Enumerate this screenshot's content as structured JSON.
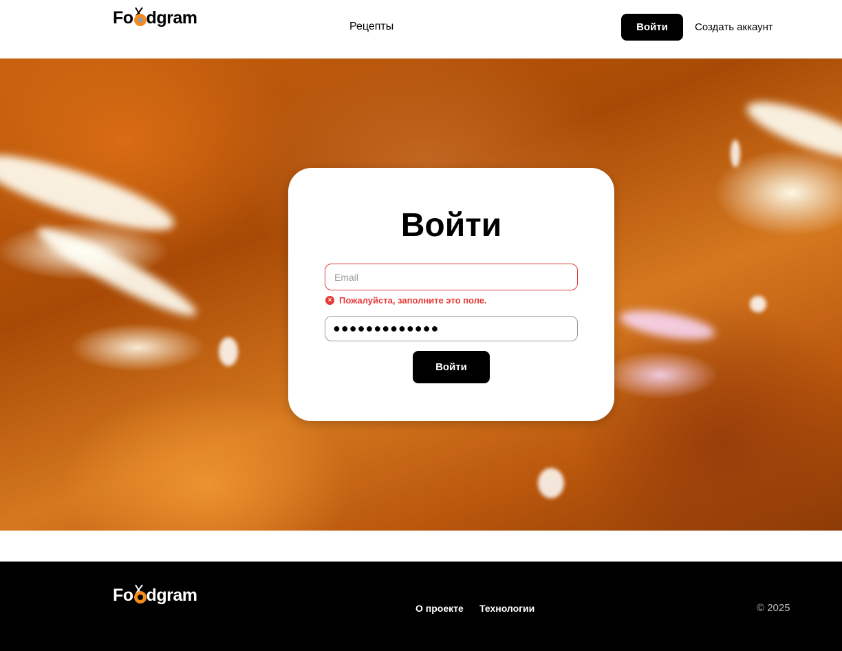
{
  "header": {
    "logo_text_pre": "Fo",
    "logo_text_post": "dgram",
    "nav_recipes": "Рецепты",
    "login_button": "Войти",
    "signup_link": "Создать аккаунт"
  },
  "login_card": {
    "title": "Войти",
    "email_placeholder": "Email",
    "email_error": "Пожалуйста, заполните это поле.",
    "password_value": "●●●●●●●●●●●●●",
    "submit_button": "Войти"
  },
  "footer": {
    "logo_text_pre": "Fo",
    "logo_text_post": "dgram",
    "about_link": "О проекте",
    "tech_link": "Технологии",
    "copyright": "© 2025"
  },
  "colors": {
    "accent": "#f58a1f",
    "error": "#e53935",
    "primary_button": "#000000"
  },
  "icons": {
    "logo": "chopsticks-bowl-icon",
    "error": "error-circle-x-icon"
  }
}
